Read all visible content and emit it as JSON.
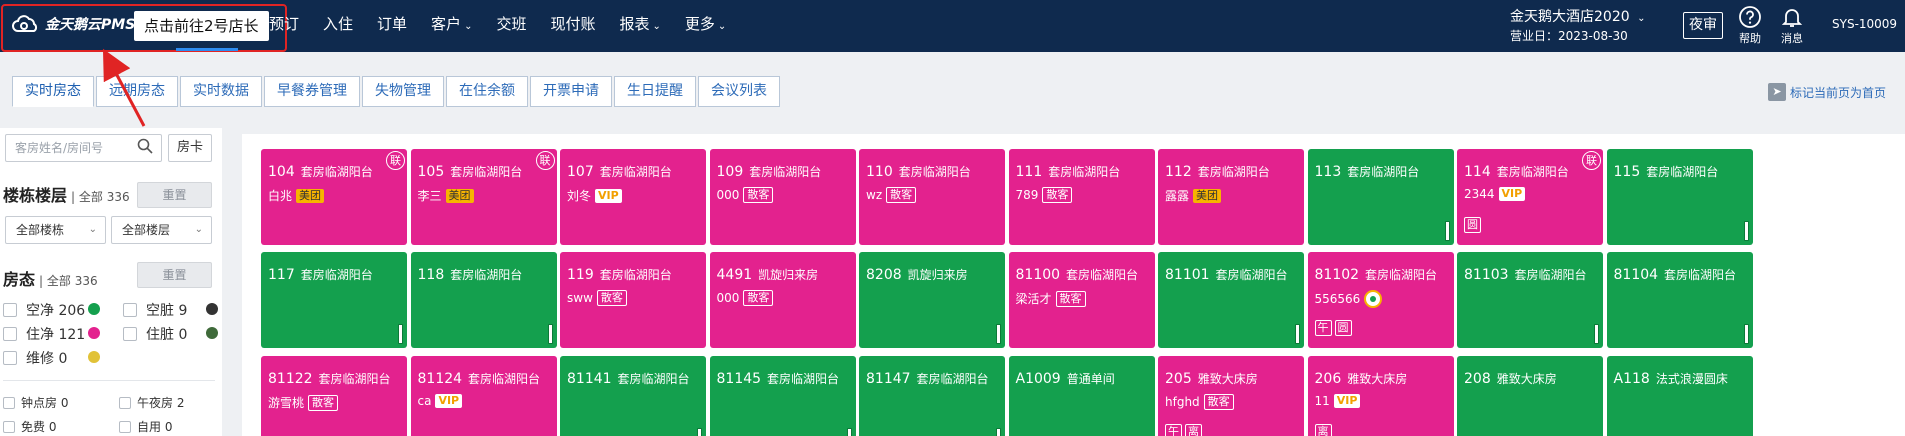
{
  "header": {
    "logo_text": "金天鹅云PMS",
    "switch_button": "点击前往2号店长",
    "nav": [
      {
        "label": "预订",
        "has_caret": false
      },
      {
        "label": "入住",
        "has_caret": false
      },
      {
        "label": "订单",
        "has_caret": false
      },
      {
        "label": "客户",
        "has_caret": true
      },
      {
        "label": "交班",
        "has_caret": false
      },
      {
        "label": "现付账",
        "has_caret": false
      },
      {
        "label": "报表",
        "has_caret": true
      },
      {
        "label": "更多",
        "has_caret": true
      }
    ],
    "hotel_name": "金天鹅大酒店2020",
    "business_date": "营业日：2023-08-30",
    "night_audit": "夜审",
    "help": "帮助",
    "messages": "消息",
    "user": "SYS-10009"
  },
  "tabs": [
    "实时房态",
    "远期房态",
    "实时数据",
    "早餐券管理",
    "失物管理",
    "在住余额",
    "开票申请",
    "生日提醒",
    "会议列表"
  ],
  "bookmark": "标记当前页为首页",
  "sidebar": {
    "search_placeholder": "客房姓名/房间号",
    "room_card": "房卡",
    "building_title": "楼栋楼层",
    "building_total": "| 全部 336",
    "reset": "重置",
    "all_buildings": "全部楼栋",
    "all_floors": "全部楼层",
    "status_title": "房态",
    "status_total": "| 全部 336",
    "status": [
      {
        "label": "空净 206",
        "color": "#14a04e"
      },
      {
        "label": "空脏 9",
        "color": "#333333"
      },
      {
        "label": "住净 121",
        "color": "#e3228e"
      },
      {
        "label": "住脏 0",
        "color": "#3f6a3a"
      },
      {
        "label": "维修 0",
        "color": "#e1c238"
      }
    ],
    "extras": [
      "钟点房 0",
      "午夜房 2",
      "免费 0",
      "自用 0"
    ]
  },
  "rooms": [
    {
      "no": "104",
      "type": "套房临湖阳台",
      "status": "occupied",
      "guest": "白兆",
      "tag": "美团",
      "tag_kind": "meituan",
      "link": "联",
      "clean": false,
      "minis": []
    },
    {
      "no": "105",
      "type": "套房临湖阳台",
      "status": "occupied",
      "guest": "李三",
      "tag": "美团",
      "tag_kind": "meituan",
      "link": "联",
      "clean": false,
      "minis": []
    },
    {
      "no": "107",
      "type": "套房临湖阳台",
      "status": "occupied",
      "guest": "刘冬",
      "tag": "VIP",
      "tag_kind": "vip",
      "link": "",
      "clean": false,
      "minis": []
    },
    {
      "no": "109",
      "type": "套房临湖阳台",
      "status": "occupied",
      "guest": "000",
      "tag": "散客",
      "tag_kind": "walkin",
      "link": "",
      "clean": false,
      "minis": []
    },
    {
      "no": "110",
      "type": "套房临湖阳台",
      "status": "occupied",
      "guest": "wz",
      "tag": "散客",
      "tag_kind": "walkin",
      "link": "",
      "clean": false,
      "minis": []
    },
    {
      "no": "111",
      "type": "套房临湖阳台",
      "status": "occupied",
      "guest": "789",
      "tag": "散客",
      "tag_kind": "walkin",
      "link": "",
      "clean": false,
      "minis": []
    },
    {
      "no": "112",
      "type": "套房临湖阳台",
      "status": "occupied",
      "guest": "露露",
      "tag": "美团",
      "tag_kind": "meituan",
      "link": "",
      "clean": false,
      "minis": []
    },
    {
      "no": "113",
      "type": "套房临湖阳台",
      "status": "vacant",
      "guest": "",
      "tag": "",
      "tag_kind": "",
      "link": "",
      "clean": true,
      "minis": []
    },
    {
      "no": "114",
      "type": "套房临湖阳台",
      "status": "occupied",
      "guest": "2344",
      "tag": "VIP",
      "tag_kind": "vip",
      "link": "联",
      "clean": false,
      "minis": [
        "圆"
      ]
    },
    {
      "no": "115",
      "type": "套房临湖阳台",
      "status": "vacant",
      "guest": "",
      "tag": "",
      "tag_kind": "",
      "link": "",
      "clean": true,
      "minis": []
    },
    {
      "no": "117",
      "type": "套房临湖阳台",
      "status": "vacant",
      "guest": "",
      "tag": "",
      "tag_kind": "",
      "link": "",
      "clean": true,
      "minis": []
    },
    {
      "no": "118",
      "type": "套房临湖阳台",
      "status": "vacant",
      "guest": "",
      "tag": "",
      "tag_kind": "",
      "link": "",
      "clean": true,
      "minis": []
    },
    {
      "no": "119",
      "type": "套房临湖阳台",
      "status": "occupied",
      "guest": "sww",
      "tag": "散客",
      "tag_kind": "walkin",
      "link": "",
      "clean": false,
      "minis": []
    },
    {
      "no": "4491",
      "type": "凯旋归来房",
      "status": "occupied",
      "guest": "000",
      "tag": "散客",
      "tag_kind": "walkin",
      "link": "",
      "clean": false,
      "minis": []
    },
    {
      "no": "8208",
      "type": "凯旋归来房",
      "status": "vacant",
      "guest": "",
      "tag": "",
      "tag_kind": "",
      "link": "",
      "clean": true,
      "minis": []
    },
    {
      "no": "81100",
      "type": "套房临湖阳台",
      "status": "occupied",
      "guest": "梁活才",
      "tag": "散客",
      "tag_kind": "walkin",
      "link": "",
      "clean": false,
      "minis": []
    },
    {
      "no": "81101",
      "type": "套房临湖阳台",
      "status": "vacant",
      "guest": "",
      "tag": "",
      "tag_kind": "",
      "link": "",
      "clean": true,
      "minis": []
    },
    {
      "no": "81102",
      "type": "套房临湖阳台",
      "status": "occupied",
      "guest": "556566",
      "tag": "",
      "tag_kind": "noon",
      "link": "",
      "clean": false,
      "minis": [
        "午",
        "圆"
      ]
    },
    {
      "no": "81103",
      "type": "套房临湖阳台",
      "status": "vacant",
      "guest": "",
      "tag": "",
      "tag_kind": "",
      "link": "",
      "clean": true,
      "minis": []
    },
    {
      "no": "81104",
      "type": "套房临湖阳台",
      "status": "vacant",
      "guest": "",
      "tag": "",
      "tag_kind": "",
      "link": "",
      "clean": true,
      "minis": []
    },
    {
      "no": "81122",
      "type": "套房临湖阳台",
      "status": "occupied",
      "guest": "游雪桃",
      "tag": "散客",
      "tag_kind": "walkin",
      "link": "",
      "clean": false,
      "minis": []
    },
    {
      "no": "81124",
      "type": "套房临湖阳台",
      "status": "occupied",
      "guest": "ca",
      "tag": "VIP",
      "tag_kind": "vip",
      "link": "",
      "clean": false,
      "minis": []
    },
    {
      "no": "81141",
      "type": "套房临湖阳台",
      "status": "vacant",
      "guest": "",
      "tag": "",
      "tag_kind": "",
      "link": "",
      "clean": true,
      "minis": []
    },
    {
      "no": "81145",
      "type": "套房临湖阳台",
      "status": "vacant",
      "guest": "",
      "tag": "",
      "tag_kind": "",
      "link": "",
      "clean": true,
      "minis": []
    },
    {
      "no": "81147",
      "type": "套房临湖阳台",
      "status": "vacant",
      "guest": "",
      "tag": "",
      "tag_kind": "",
      "link": "",
      "clean": true,
      "minis": []
    },
    {
      "no": "A1009",
      "type": "普通单间",
      "status": "vacant",
      "guest": "",
      "tag": "",
      "tag_kind": "",
      "link": "",
      "clean": false,
      "minis": []
    },
    {
      "no": "205",
      "type": "雅致大床房",
      "status": "occupied",
      "guest": "hfghd",
      "tag": "散客",
      "tag_kind": "walkin",
      "link": "",
      "clean": false,
      "minis": [
        "午",
        "离"
      ]
    },
    {
      "no": "206",
      "type": "雅致大床房",
      "status": "occupied",
      "guest": "11",
      "tag": "VIP",
      "tag_kind": "vip",
      "link": "",
      "clean": false,
      "minis": [
        "离"
      ]
    },
    {
      "no": "208",
      "type": "雅致大床房",
      "status": "vacant",
      "guest": "",
      "tag": "",
      "tag_kind": "",
      "link": "",
      "clean": false,
      "minis": []
    },
    {
      "no": "A118",
      "type": "法式浪漫圆床",
      "status": "vacant",
      "guest": "",
      "tag": "",
      "tag_kind": "",
      "link": "",
      "clean": false,
      "minis": []
    }
  ]
}
